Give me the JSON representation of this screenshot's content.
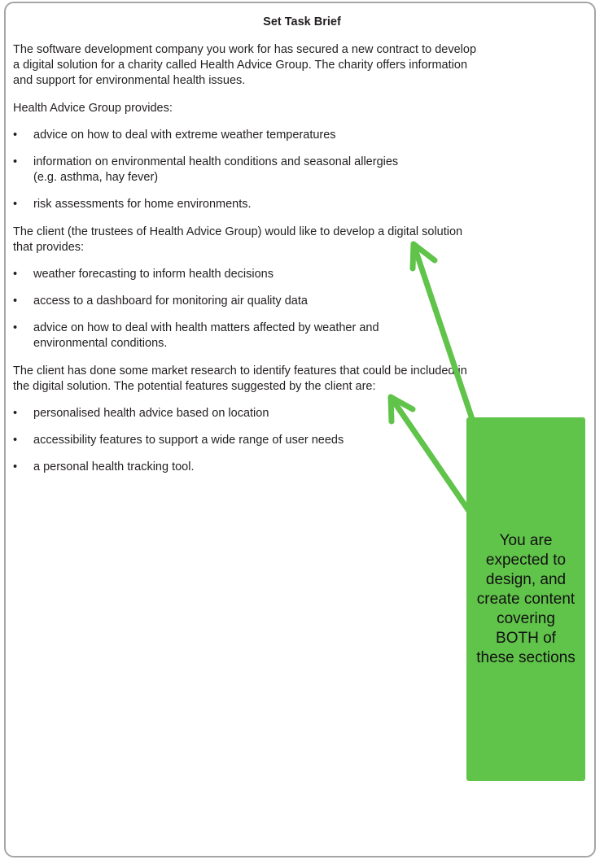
{
  "document": {
    "title": "Set Task Brief",
    "intro": [
      "The software development company you work for has secured a new contract to develop",
      "a digital solution for a charity called Health Advice Group. The charity offers information",
      "and support for environmental health issues."
    ],
    "provides_heading": "Health Advice Group provides:",
    "provides_items": [
      [
        "advice on how to deal with extreme weather temperatures"
      ],
      [
        "information on environmental health conditions and seasonal allergies",
        "(e.g. asthma, hay fever)"
      ],
      [
        "risk assessments for home environments."
      ]
    ],
    "client_para": [
      "The client (the trustees of Health Advice Group) would like to develop a digital solution",
      "that provides:"
    ],
    "client_items": [
      [
        "weather forecasting to inform health decisions"
      ],
      [
        "access to a dashboard for monitoring air quality data"
      ],
      [
        "advice on how to deal with health matters affected by weather and",
        "environmental conditions."
      ]
    ],
    "research_para": [
      "The client has done some market research to identify features that could be included in",
      "the digital solution. The potential features suggested by the client are:"
    ],
    "feature_items": [
      [
        "personalised health advice based on location"
      ],
      [
        "accessibility features to support a wide range of user needs"
      ],
      [
        "a personal health tracking tool."
      ]
    ]
  },
  "annotation": {
    "lines": [
      "You are",
      "expected to",
      "design, and",
      "create content",
      "covering",
      "BOTH of",
      "these sections"
    ],
    "color": "#60c34a"
  }
}
